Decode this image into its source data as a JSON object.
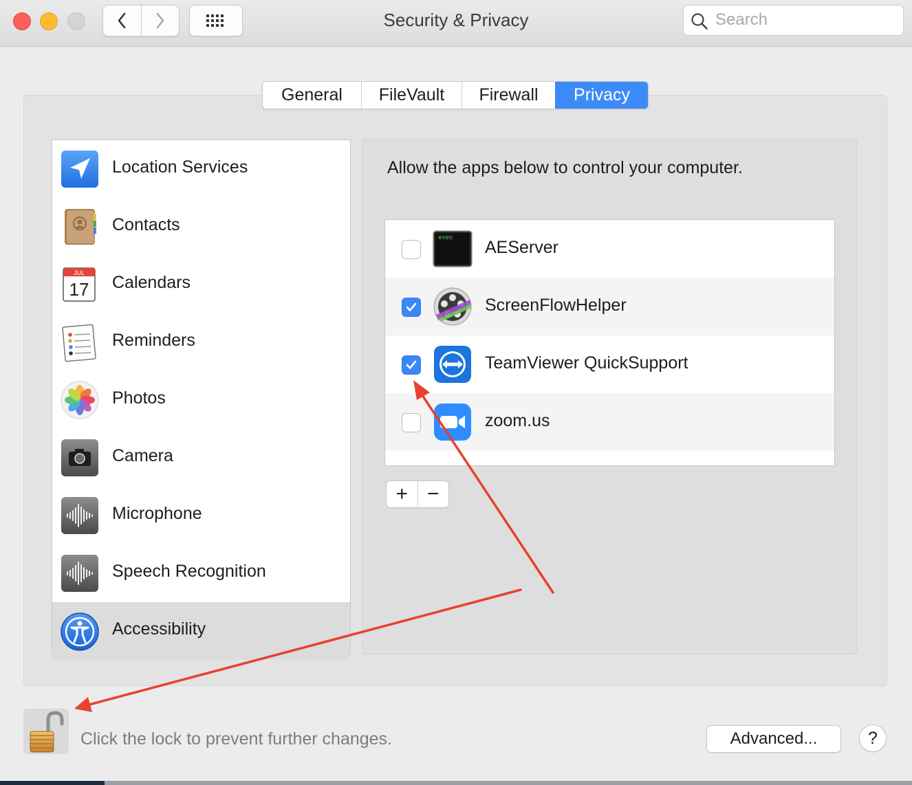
{
  "window": {
    "title": "Security & Privacy"
  },
  "search": {
    "placeholder": "Search",
    "value": ""
  },
  "tabs": [
    {
      "label": "General",
      "active": false
    },
    {
      "label": "FileVault",
      "active": false
    },
    {
      "label": "Firewall",
      "active": false
    },
    {
      "label": "Privacy",
      "active": true
    }
  ],
  "categories": [
    {
      "label": "Location Services",
      "icon": "location-services-icon",
      "selected": false
    },
    {
      "label": "Contacts",
      "icon": "contacts-icon",
      "selected": false
    },
    {
      "label": "Calendars",
      "icon": "calendar-icon",
      "selected": false,
      "month": "JUL",
      "day": "17"
    },
    {
      "label": "Reminders",
      "icon": "reminders-icon",
      "selected": false
    },
    {
      "label": "Photos",
      "icon": "photos-icon",
      "selected": false
    },
    {
      "label": "Camera",
      "icon": "camera-icon",
      "selected": false
    },
    {
      "label": "Microphone",
      "icon": "microphone-icon",
      "selected": false
    },
    {
      "label": "Speech Recognition",
      "icon": "speech-recognition-icon",
      "selected": false
    },
    {
      "label": "Accessibility",
      "icon": "accessibility-icon",
      "selected": true
    }
  ],
  "panel": {
    "description": "Allow the apps below to control your computer.",
    "apps": [
      {
        "name": "AEServer",
        "checked": false,
        "icon": "terminal-exec-icon",
        "icon_text": "exec"
      },
      {
        "name": "ScreenFlowHelper",
        "checked": true,
        "icon": "screenflow-icon"
      },
      {
        "name": "TeamViewer QuickSupport",
        "checked": true,
        "icon": "teamviewer-icon"
      },
      {
        "name": "zoom.us",
        "checked": false,
        "icon": "zoom-icon"
      }
    ],
    "add_label": "+",
    "remove_label": "−"
  },
  "footer": {
    "lock_text": "Click the lock to prevent further changes.",
    "advanced_label": "Advanced...",
    "help_label": "?"
  },
  "colors": {
    "accent": "#3d8bf7",
    "annotation_arrow": "#e8412f"
  }
}
